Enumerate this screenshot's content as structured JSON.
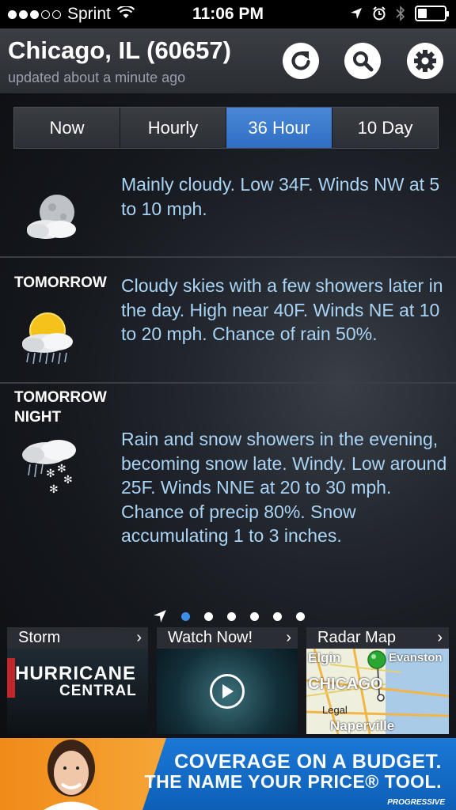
{
  "status": {
    "carrier": "Sprint",
    "time": "11:06 PM",
    "battery_level": 0.35
  },
  "header": {
    "city": "Chicago, IL (60657)",
    "updated": "updated about a minute ago",
    "icons": [
      "refresh-icon",
      "search-icon",
      "gear-icon"
    ]
  },
  "tabs": [
    {
      "label": "Now",
      "active": false
    },
    {
      "label": "Hourly",
      "active": false
    },
    {
      "label": "36 Hour",
      "active": true
    },
    {
      "label": "10 Day",
      "active": false
    }
  ],
  "forecast": [
    {
      "label": "",
      "text": "Mainly cloudy. Low 34F. Winds NW at 5 to 10 mph.",
      "icon": "cloudy-night-icon"
    },
    {
      "label": "TOMORROW",
      "text": "Cloudy skies with a few showers later in the day. High near 40F. Winds NE at 10 to 20 mph. Chance of rain 50%.",
      "icon": "sun-showers-icon"
    },
    {
      "label": "TOMORROW NIGHT",
      "text": "Rain and snow showers in the evening, becoming snow late. Windy. Low around 25F. Winds NNE at 20 to 30 mph. Chance of precip 80%. Snow accumulating 1 to 3 inches.",
      "icon": "rain-snow-icon"
    }
  ],
  "pager": {
    "pages": 6,
    "current": 1
  },
  "cards": [
    {
      "title": "Storm",
      "body_line1": "HURRICANE",
      "body_line2": "CENTRAL"
    },
    {
      "title": "Watch Now!"
    },
    {
      "title": "Radar Map",
      "map_labels": [
        "Elgin",
        "Evanston",
        "CHICAGO",
        "Legal",
        "Naperville"
      ]
    }
  ],
  "ad": {
    "line1": "COVERAGE ON A BUDGET.",
    "line2": "THE NAME YOUR PRICE® TOOL.",
    "brand": "PROGRESSIVE"
  }
}
